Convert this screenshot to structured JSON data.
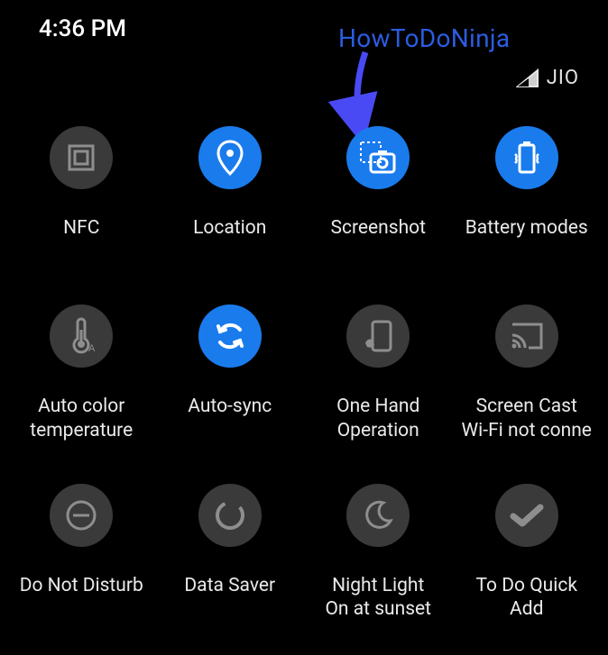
{
  "status": {
    "time": "4:36 PM",
    "carrier": "JIO"
  },
  "annotation": {
    "text": "HowToDoNinja"
  },
  "tiles": {
    "nfc": {
      "label": "NFC"
    },
    "location": {
      "label": "Location"
    },
    "screenshot": {
      "label": "Screenshot"
    },
    "battery": {
      "label": "Battery modes"
    },
    "autocolor": {
      "label": "Auto color\ntemperature"
    },
    "autosync": {
      "label": "Auto-sync"
    },
    "onehand": {
      "label": "One Hand\nOperation"
    },
    "screencast": {
      "label": "Screen Cast\nWi-Fi not conne"
    },
    "dnd": {
      "label": "Do Not Disturb"
    },
    "datasaver": {
      "label": "Data Saver"
    },
    "nightlight": {
      "label": "Night Light\nOn at sunset"
    },
    "todo": {
      "label": "To Do Quick\nAdd"
    }
  }
}
